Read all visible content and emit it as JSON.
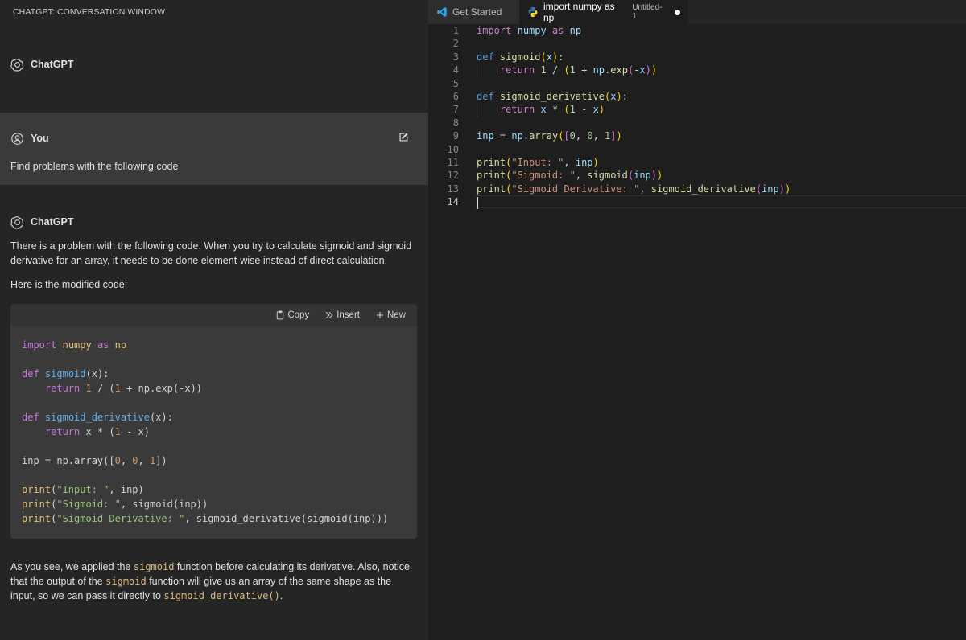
{
  "chat": {
    "header": "CHATGPT: CONVERSATION WINDOW",
    "assistant_name": "ChatGPT",
    "user_name": "You",
    "user_message": "Find problems with the following code",
    "reply_p1": "There is a problem with the following code. When you try to calculate sigmoid and sigmoid derivative for an array, it needs to be done element-wise instead of direct calculation.",
    "reply_p2": "Here is the modified code:",
    "code_actions": {
      "copy": "Copy",
      "insert": "Insert",
      "new": "New"
    },
    "reply_p3_a": "As you see, we applied the ",
    "reply_p3_b": "sigmoid",
    "reply_p3_c": " function before calculating its derivative. Also, notice that the output of the ",
    "reply_p3_d": "sigmoid",
    "reply_p3_e": " function will give us an array of the same shape as the input, so we can pass it directly to ",
    "reply_p3_f": "sigmoid_derivative()",
    "reply_p3_g": "."
  },
  "editor": {
    "tabs": [
      {
        "label": "Get Started",
        "icon": "vscode-icon"
      },
      {
        "label": "import numpy as np",
        "sub": "Untitled-1",
        "icon": "python-icon",
        "unsaved": true
      }
    ],
    "active_line": 14,
    "line_count": 14
  },
  "colors": {
    "accent": "#0078d4",
    "panel_bg": "#252526",
    "editor_bg": "#1e1e1e",
    "user_block_bg": "#3a3a3a"
  }
}
